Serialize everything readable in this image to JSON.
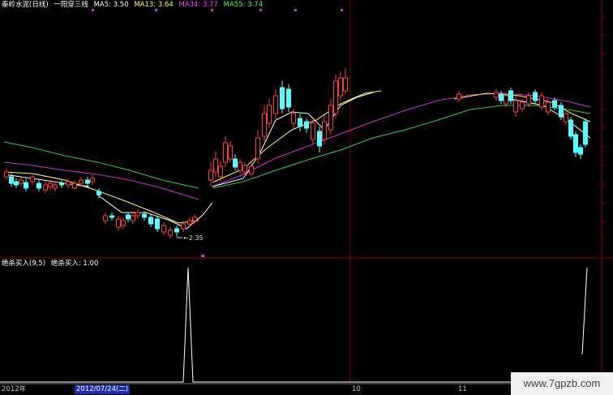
{
  "header": {
    "stock_title": "秦岭水泥(日线)",
    "indicator_title": "一阳穿三线",
    "ma": [
      {
        "label": "MA5: 3.50",
        "color": "#ffffff"
      },
      {
        "label": "MA13: 3.64",
        "color": "#ffff55"
      },
      {
        "label": "MA34: 3.77",
        "color": "#ff44ff"
      },
      {
        "label": "MA55: 3.74",
        "color": "#55ff55"
      }
    ]
  },
  "sub_panel": {
    "title": "绝杀买入(9,5)",
    "value_label": "绝杀买入: 1.00"
  },
  "low_annotation": "2.35",
  "axis": {
    "year": "2012年",
    "selected_date": "2012/07/24(二)",
    "month_10": "10",
    "month_11": "11"
  },
  "watermark": "www.7gpzb.com",
  "colors": {
    "up": "#ff3d3d",
    "down": "#54ffff",
    "ma5": "#ffffff",
    "ma13": "#ffff55",
    "ma34": "#cc33cc",
    "ma55": "#33cc55",
    "grid": "#8b0000",
    "signal": "#ffffff"
  }
}
